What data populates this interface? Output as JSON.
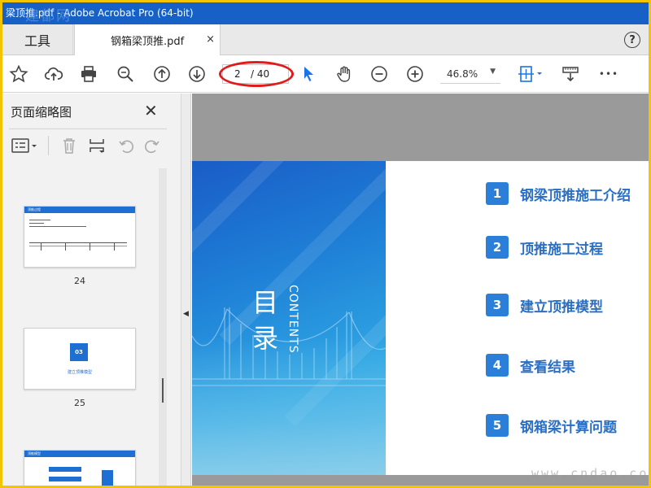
{
  "window": {
    "title": "梁顶推.pdf - Adobe Acrobat Pro (64-bit)",
    "watermark_top": "建都网"
  },
  "tabs": {
    "tools_label": "工具",
    "document_label": "钢箱梁顶推.pdf",
    "close_glyph": "×",
    "help_glyph": "?"
  },
  "toolbar": {
    "icons": [
      "star-icon",
      "cloud-upload-icon",
      "print-icon",
      "zoom-search-icon",
      "page-up-icon",
      "page-down-icon",
      "select-arrow-icon",
      "hand-icon",
      "zoom-out-icon",
      "zoom-in-icon",
      "fit-page-icon",
      "scroll-mode-icon",
      "more-icon"
    ],
    "page_current": "2",
    "page_total": "/ 40",
    "zoom_value": "46.8%",
    "more_glyph": "•••"
  },
  "left_panel": {
    "title": "页面缩略图",
    "close_glyph": "✕",
    "thumbnails": [
      {
        "label": "24",
        "header_text": "顶推过程"
      },
      {
        "label": "25",
        "badge": "03",
        "caption": "建立顶推模型"
      },
      {
        "label": "",
        "header_text": "顶推模型"
      }
    ]
  },
  "document": {
    "cover_title_top": "目",
    "cover_title_bottom": "录",
    "cover_subtitle": "CONTENTS",
    "toc": [
      {
        "number": "1",
        "text": "钢梁顶推施工介绍"
      },
      {
        "number": "2",
        "text": "顶推施工过程"
      },
      {
        "number": "3",
        "text": "建立顶推模型"
      },
      {
        "number": "4",
        "text": "查看结果"
      },
      {
        "number": "5",
        "text": "钢箱梁计算问题"
      }
    ]
  },
  "watermark_bottom": "www.cndao.com",
  "colors": {
    "titlebar": "#1761c6",
    "accent": "#2b7fd8",
    "annotation_red": "#e01b1b",
    "outer_border": "#f3c500"
  }
}
